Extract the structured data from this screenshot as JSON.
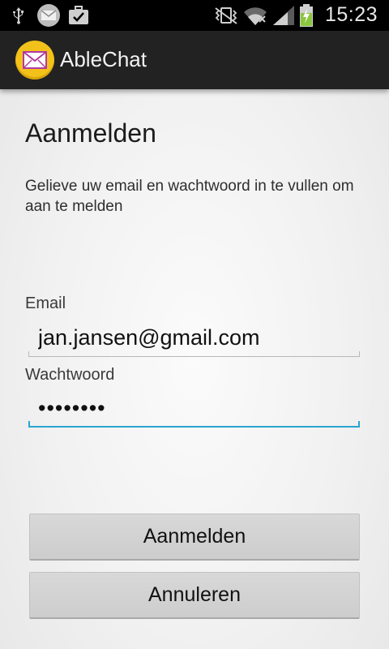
{
  "status_bar": {
    "time": "15:23",
    "icons": [
      "usb-icon",
      "email-notification-icon",
      "briefcase-check-icon",
      "vibrate-icon",
      "wifi-icon",
      "signal-icon",
      "battery-charging-icon"
    ]
  },
  "action_bar": {
    "app_icon": "mail-envelope-icon",
    "title": "AbleChat"
  },
  "login": {
    "title": "Aanmelden",
    "instructions": "Gelieve uw email en wachtwoord in te vullen om aan te melden",
    "email_label": "Email",
    "email_value": "jan.jansen@gmail.com",
    "password_label": "Wachtwoord",
    "password_value": "••••••••",
    "submit_label": "Aanmelden",
    "cancel_label": "Annuleren"
  },
  "colors": {
    "accent": "#2aa5cf",
    "action_bar": "#222222",
    "app_icon_bg": "#f2c21b",
    "battery_green": "#8bc43f"
  }
}
